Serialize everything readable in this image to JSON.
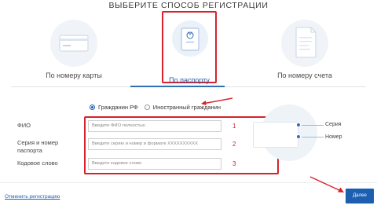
{
  "header": {
    "title": "ВЫБЕРИТЕ СПОСОБ РЕГИСТРАЦИИ"
  },
  "methods": [
    {
      "label": "По номеру карты",
      "icon": "card-icon"
    },
    {
      "label": "По паспорту",
      "icon": "passport-icon",
      "active": true
    },
    {
      "label": "По номеру счета",
      "icon": "document-icon"
    }
  ],
  "citizenship": {
    "options": [
      "Гражданин РФ",
      "Иностранный гражданин"
    ],
    "selected": "Гражданин РФ"
  },
  "form": {
    "fio_label": "ФИО",
    "fio_placeholder": "Введите ФИО полностью",
    "passport_label": "Серия и номер паспорта",
    "passport_placeholder": "Введите серию и номер в формате XXXXXXXXXX",
    "code_label": "Кодовое слово",
    "code_placeholder": "Введите кодовое слово",
    "markers": [
      "1",
      "2",
      "3"
    ]
  },
  "illustration": {
    "series_label": "Серия",
    "number_label": "Номер"
  },
  "footer": {
    "cancel_label": "Отменить регистрацию",
    "next_label": "Далее"
  },
  "colors": {
    "accent": "#1c5fb0",
    "highlight": "#d7222d"
  }
}
